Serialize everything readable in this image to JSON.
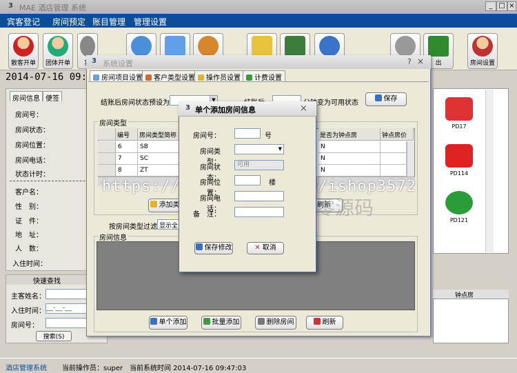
{
  "window": {
    "title": "MAE 酒店管理 系统"
  },
  "menu": [
    "宾客登记",
    "房间预定",
    "账目管理",
    "管理设置"
  ],
  "toolbar": {
    "buttons": [
      "散客开单",
      "团体开单",
      "宾",
      "",
      "",
      "",
      "",
      "",
      "",
      "",
      "出",
      "房间设置"
    ]
  },
  "date_display": "2014-07-16 09:4",
  "left_panel": {
    "tabs": [
      "房间信息",
      "便签"
    ],
    "fields": [
      "房间号：",
      "房间状态：",
      "房间位置：",
      "房间电话：",
      "状态计时："
    ],
    "guest_fields": [
      "客户名：",
      "性　别：",
      "证　件：",
      "地　址：",
      "人　数：",
      "入住时间："
    ]
  },
  "quick_search": {
    "title": "快速查找",
    "name_label": "主客姓名：",
    "checkin_label": "入住时间：",
    "checkin_placeholder": "__-__-__",
    "room_label": "房间号：",
    "search_button": "搜索(S)"
  },
  "rooms": [
    "PD17",
    "PD114",
    "PD121"
  ],
  "right_bottom_header": "钟点房",
  "statusbar": {
    "system": "酒店管理系统",
    "operator": "当前操作员：super",
    "systime": "当前系统时间  2014-07-16 09:47:03"
  },
  "settings_dialog": {
    "title": "系统设置",
    "tabs": [
      "房间项目设置",
      "客户类型设置",
      "操作员设置",
      "计费设置"
    ],
    "after_checkout_label": "结账后房间状态预设为：",
    "after_checkout2_label": "结账后",
    "minutes_label": "分钟变为可用状态",
    "save_button": "保存",
    "room_type_group": "房间类型",
    "columns": [
      "编号",
      "房间类型简称",
      "是否为钟点房",
      "钟点房价"
    ],
    "rows": [
      {
        "id": "6",
        "short": "SB",
        "hourly": "N"
      },
      {
        "id": "7",
        "short": "SC",
        "hourly": "N"
      },
      {
        "id": "8",
        "short": "ZT",
        "hourly": "N"
      }
    ],
    "add_type_button": "添加类",
    "refresh_button": "刷新",
    "filter_label": "按房间类型过滤：",
    "filter_value": "显示全",
    "room_info_group": "房间信息",
    "bottom_buttons": [
      "单个添加",
      "批量添加",
      "删除房间",
      "刷新"
    ]
  },
  "modal": {
    "title": "单个添加房间信息",
    "room_no_label": "房间号：",
    "room_no_suffix": "号",
    "room_type_label": "房间类型：",
    "room_status_label": "房间状态：",
    "room_status_value": "可用",
    "room_pos_label": "房间位置：",
    "room_pos_suffix": "楼",
    "room_phone_label": "房间电话：",
    "note_label": "备　注：",
    "save_button": "保存修改",
    "cancel_button": "取消"
  },
  "watermark": "https://www.huzhan.com/ishop3572",
  "watermark2": "八零源码",
  "colors": {
    "menubar": "#0c4d9a",
    "grid_bg": "#808080"
  }
}
